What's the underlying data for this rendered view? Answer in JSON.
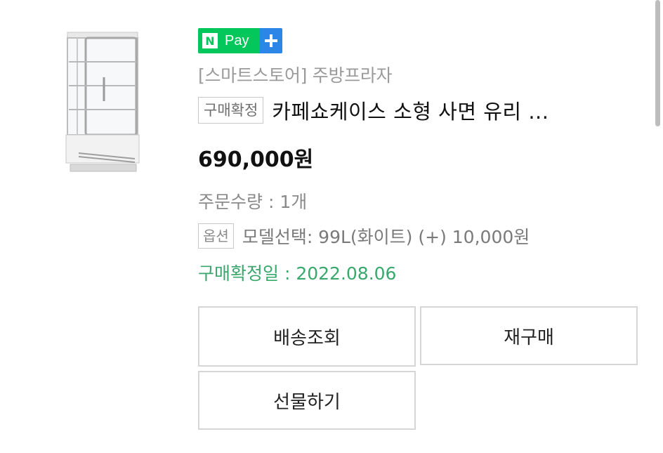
{
  "badge": {
    "n_letter": "N",
    "pay_label": "Pay",
    "plus_icon": "plus-icon",
    "colors": {
      "green": "#03c75a",
      "blue": "#2b86e8"
    }
  },
  "product": {
    "image_icon": "display-fridge-image",
    "store_label": "[스마트스토어] 주방프라자",
    "status_tag": "구매확정",
    "title": "카페쇼케이스 소형 사면 유리 ...",
    "price": "690,000원",
    "quantity": "주문수량 : 1개",
    "option_tag": "옵션",
    "option_text": "모델선택: 99L(화이트) (+) 10,000원",
    "confirm_date": "구매확정일 : 2022.08.06",
    "confirm_color": "#3aa76d"
  },
  "actions": {
    "track_label": "배송조회",
    "rebuy_label": "재구매",
    "gift_label": "선물하기"
  }
}
